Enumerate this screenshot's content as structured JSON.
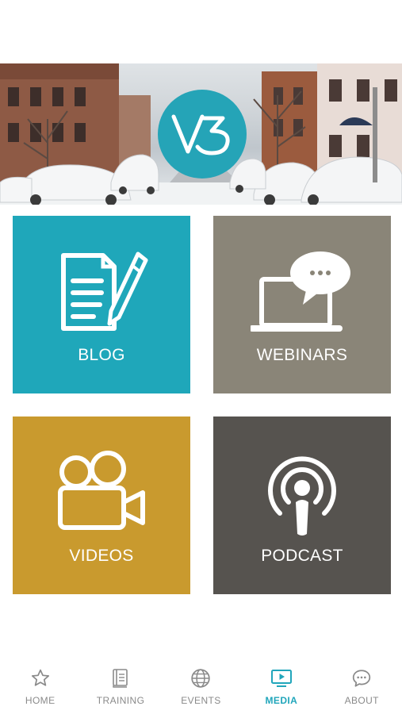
{
  "hero": {
    "logo_text": "V3",
    "accent_color": "#25a4b7"
  },
  "tiles": [
    {
      "label": "BLOG",
      "icon": "document-pencil-icon",
      "color": "#1fa7ba"
    },
    {
      "label": "WEBINARS",
      "icon": "laptop-chat-icon",
      "color": "#8a8578"
    },
    {
      "label": "VIDEOS",
      "icon": "video-camera-icon",
      "color": "#c99a2e"
    },
    {
      "label": "PODCAST",
      "icon": "podcast-icon",
      "color": "#56534f"
    }
  ],
  "tabbar": {
    "items": [
      {
        "label": "HOME",
        "icon": "star-icon"
      },
      {
        "label": "TRAINING",
        "icon": "book-icon"
      },
      {
        "label": "EVENTS",
        "icon": "globe-icon"
      },
      {
        "label": "MEDIA",
        "icon": "play-screen-icon",
        "active": true
      },
      {
        "label": "ABOUT",
        "icon": "chat-bubble-icon"
      }
    ],
    "active_color": "#21a6bb"
  }
}
